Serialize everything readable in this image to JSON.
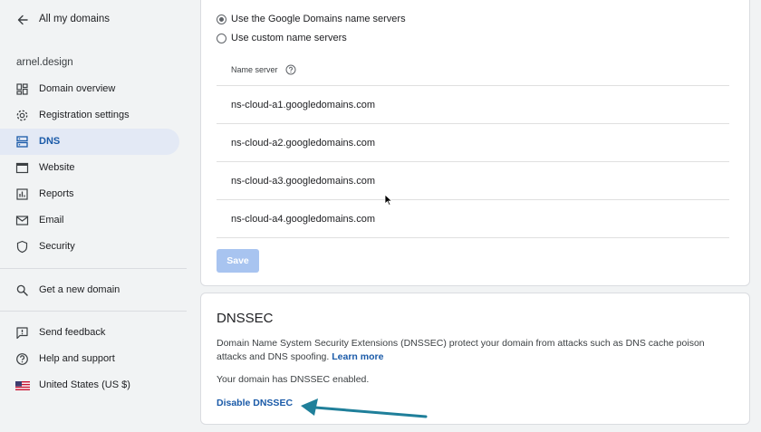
{
  "sidebar": {
    "back_label": "All my domains",
    "domain": "arnel.design",
    "items": [
      {
        "label": "Domain overview",
        "icon": "dashboard-icon"
      },
      {
        "label": "Registration settings",
        "icon": "gear-icon"
      },
      {
        "label": "DNS",
        "icon": "dns-icon",
        "active": true
      },
      {
        "label": "Website",
        "icon": "website-icon"
      },
      {
        "label": "Reports",
        "icon": "reports-icon"
      },
      {
        "label": "Email",
        "icon": "email-icon"
      },
      {
        "label": "Security",
        "icon": "shield-icon"
      }
    ],
    "get_domain": "Get a new domain",
    "feedback": "Send feedback",
    "help": "Help and support",
    "region": "United States (US $)"
  },
  "nameservers": {
    "option_google": "Use the Google Domains name servers",
    "option_custom": "Use custom name servers",
    "selected": "google",
    "column_header": "Name server",
    "servers": [
      "ns-cloud-a1.googledomains.com",
      "ns-cloud-a2.googledomains.com",
      "ns-cloud-a3.googledomains.com",
      "ns-cloud-a4.googledomains.com"
    ],
    "save_label": "Save"
  },
  "dnssec": {
    "title": "DNSSEC",
    "description": "Domain Name System Security Extensions (DNSSEC) protect your domain from attacks such as DNS cache poison attacks and DNS spoofing.",
    "learn_more": "Learn more",
    "status": "Your domain has DNSSEC enabled.",
    "disable_label": "Disable DNSSEC"
  },
  "colors": {
    "accent": "#1a5aa8",
    "active_bg": "#e3e9f5",
    "annotation_arrow": "#1f7f9a",
    "save_disabled": "#a8c4f0"
  }
}
